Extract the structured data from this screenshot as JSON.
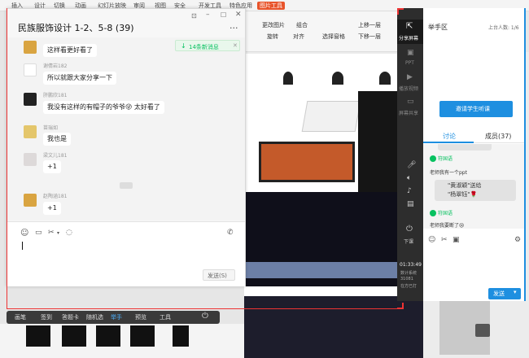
{
  "ppt": {
    "tabs": [
      "插入",
      "设计",
      "切换",
      "动画",
      "幻灯片放映",
      "审阅",
      "视图",
      "安全",
      "开发工具",
      "特色应用",
      "图片工具"
    ],
    "ribbon": {
      "row1": [
        "更改图片",
        "组合",
        "上移一层"
      ],
      "row2": [
        "旋转",
        "对齐",
        "选择窗格",
        "下移一层"
      ]
    }
  },
  "chat": {
    "title": "民族服饰设计 1-2、5-8 (39)",
    "menu": "···",
    "new_msgs": "14条新消息",
    "divider": "",
    "messages": [
      {
        "name": "",
        "text": "这样看更好看了",
        "avatar_color": "#d9a441"
      },
      {
        "name": "谢倩岩182",
        "text": "所以就跟大家分享一下",
        "avatar_color": "#ffffff"
      },
      {
        "name": "肝鹏欣181",
        "text": "我没有这样的有帽子的爷爷😜 太好看了",
        "avatar_color": "#222222"
      },
      {
        "name": "苗瑞如",
        "text": "我也是",
        "avatar_color": "#e4c66b"
      },
      {
        "name": "梁文儿181",
        "text": "+1",
        "avatar_color": "#ddd9d9"
      },
      {
        "name": "赵陶涵181",
        "text": "+1",
        "avatar_color": "#d9a441"
      }
    ],
    "send_label": "发送(S)"
  },
  "panel": {
    "title": "举手区",
    "online": "上台人数: 1/6",
    "invite_label": "邀请学生听课",
    "tabs": [
      "讨论",
      "成员(37)"
    ],
    "side_tools": [
      "分享屏幕",
      "PPT",
      "播放视频",
      "屏幕共享"
    ],
    "chat": [
      {
        "user": "符国语",
        "text": "老师我有一个ppt"
      },
      {
        "user": "",
        "text": "\"黄淑颖\"送给\n\"杨翠钰\"🌹"
      },
      {
        "user": "符国语",
        "text": "老师我要断了😢"
      }
    ],
    "clock": "01:33:49",
    "status_lines": [
      "数计系统",
      "31081",
      "在方已打"
    ],
    "exit_label": "下课",
    "send_label": "发送"
  },
  "bottom_bar": {
    "items": [
      "画笔",
      "签到",
      "答题卡",
      "随机选",
      "举手",
      "预览",
      "工具"
    ]
  }
}
